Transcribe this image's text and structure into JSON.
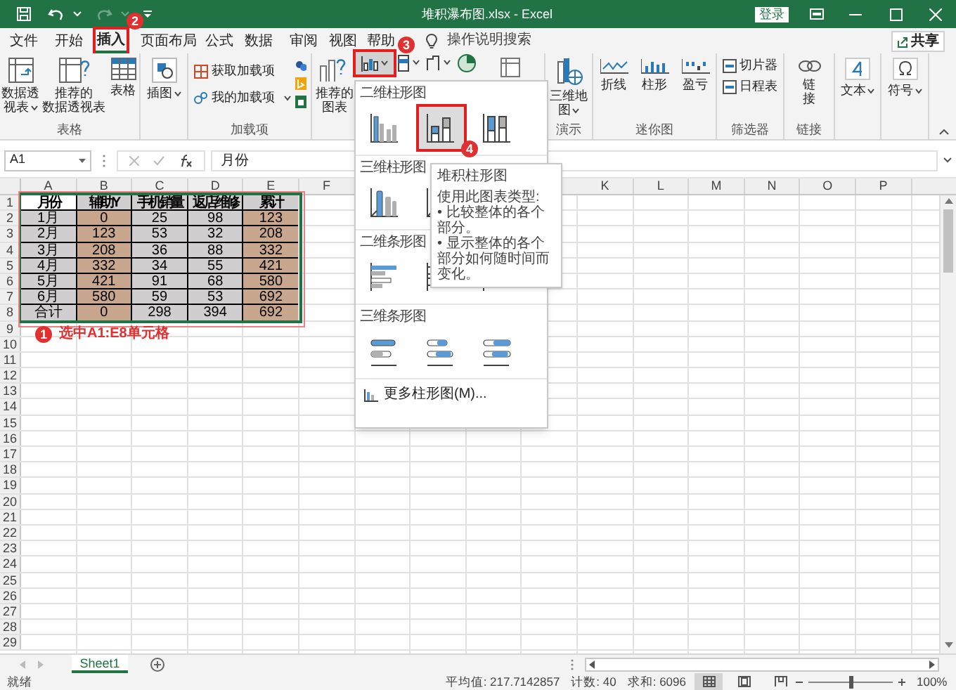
{
  "title_bar": {
    "title": "堆积瀑布图.xlsx - Excel",
    "sign_in": "登录"
  },
  "ribbon_tabs": [
    {
      "label": "文件",
      "selected": false,
      "highlighted": false
    },
    {
      "label": "开始",
      "selected": false,
      "highlighted": false
    },
    {
      "label": "插入",
      "selected": true,
      "highlighted": true
    },
    {
      "label": "页面布局",
      "selected": false,
      "highlighted": false
    },
    {
      "label": "公式",
      "selected": false,
      "highlighted": false
    },
    {
      "label": "数据",
      "selected": false,
      "highlighted": false
    },
    {
      "label": "审阅",
      "selected": false,
      "highlighted": false
    },
    {
      "label": "视图",
      "selected": false,
      "highlighted": false
    },
    {
      "label": "帮助",
      "selected": false,
      "highlighted": false
    }
  ],
  "search": {
    "placeholder": "操作说明搜索"
  },
  "share": "共享",
  "ribbon": {
    "tables": {
      "label": "表格",
      "pivot": [
        "数据透",
        "视表"
      ],
      "recommended_pivot": [
        "推荐的",
        "数据透视表"
      ],
      "table": [
        "表格"
      ]
    },
    "illustrations": {
      "button": [
        "插图"
      ]
    },
    "addins": {
      "label": "加载项",
      "get": "获取加载项",
      "mine": "我的加载项"
    },
    "charts": {
      "recommended": [
        "推荐的",
        "图表"
      ],
      "column_button": {
        "highlighted": true,
        "pressed": true
      }
    },
    "tours": {
      "label": "演示",
      "map": [
        "三维地",
        "图"
      ]
    },
    "sparklines": {
      "label": "迷你图",
      "line": "折线",
      "column": "柱形",
      "win_loss": "盈亏"
    },
    "filters": {
      "label": "筛选器",
      "slicer": "切片器",
      "timeline": "日程表"
    },
    "links": {
      "label": "链接",
      "link": [
        "链",
        "接"
      ]
    },
    "text": {
      "button": [
        "文本"
      ]
    },
    "symbols": {
      "button": [
        "符号"
      ]
    }
  },
  "formula_bar": {
    "name_box": "A1",
    "value": "月份"
  },
  "columns_left": [
    "A",
    "B",
    "C",
    "D",
    "E",
    "F"
  ],
  "columns_right": [
    "K",
    "L",
    "M",
    "N",
    "O",
    "P"
  ],
  "row_numbers": [
    "1",
    "2",
    "3",
    "4",
    "5",
    "6",
    "7",
    "8",
    "9",
    "10",
    "11",
    "12",
    "13",
    "14",
    "15",
    "16",
    "17",
    "18",
    "19",
    "20",
    "21",
    "22",
    "23",
    "24",
    "25",
    "26",
    "27",
    "28",
    "29"
  ],
  "data_table": {
    "selected": true,
    "highlighted": true,
    "header": [
      {
        "text": "月份",
        "active": true
      },
      {
        "text": "辅助Y",
        "active": false
      },
      {
        "text": "手机销量",
        "active": false
      },
      {
        "text": "返店维修",
        "active": false
      },
      {
        "text": "累计",
        "active": false
      }
    ],
    "rows": [
      [
        "1月",
        "0",
        "25",
        "98",
        "123"
      ],
      [
        "2月",
        "123",
        "53",
        "32",
        "208"
      ],
      [
        "3月",
        "208",
        "36",
        "88",
        "332"
      ],
      [
        "4月",
        "332",
        "34",
        "55",
        "421"
      ],
      [
        "5月",
        "421",
        "91",
        "68",
        "580"
      ],
      [
        "6月",
        "580",
        "59",
        "53",
        "692"
      ],
      [
        "合计",
        "0",
        "298",
        "394",
        "692"
      ]
    ]
  },
  "chart_menu": {
    "sections": [
      {
        "title": "二维柱形图",
        "kind": "column",
        "options": [
          {
            "selected": false,
            "highlighted": false
          },
          {
            "selected": true,
            "highlighted": true
          },
          {
            "selected": false,
            "highlighted": false
          }
        ]
      },
      {
        "title": "三维柱形图",
        "kind": "column3d",
        "options": [
          {
            "selected": false,
            "highlighted": false
          },
          {
            "selected": false,
            "highlighted": false
          }
        ]
      },
      {
        "title": "二维条形图",
        "kind": "bar",
        "options": [
          {
            "selected": false,
            "highlighted": false
          },
          {
            "selected": false,
            "highlighted": false
          },
          {
            "selected": false,
            "highlighted": false
          }
        ]
      },
      {
        "title": "三维条形图",
        "kind": "bar3d",
        "options": [
          {
            "selected": false,
            "highlighted": false
          },
          {
            "selected": false,
            "highlighted": false
          },
          {
            "selected": false,
            "highlighted": false
          }
        ]
      }
    ],
    "more": "更多柱形图(M)..."
  },
  "tooltip": {
    "title": "堆积柱形图",
    "lines": [
      "使用此图表类型:",
      "• 比较整体的各个部分。",
      "• 显示整体的各个部分如何随时间而变化。"
    ]
  },
  "annotations": [
    {
      "number": "1",
      "text": "选中A1:E8单元格"
    },
    {
      "number": "2"
    },
    {
      "number": "3"
    },
    {
      "number": "4"
    }
  ],
  "sheet_tabs": [
    {
      "label": "Sheet1",
      "selected": true
    }
  ],
  "status_bar": {
    "ready": "就绪",
    "average": "平均值: 217.7142857",
    "count": "计数: 40",
    "sum": "求和: 6096",
    "views": [
      {
        "kind": "normal",
        "selected": true
      },
      {
        "kind": "page_layout",
        "selected": false
      },
      {
        "kind": "page_break",
        "selected": false
      }
    ],
    "zoom": {
      "level": 0.5
    },
    "zoom_text": "100%"
  }
}
